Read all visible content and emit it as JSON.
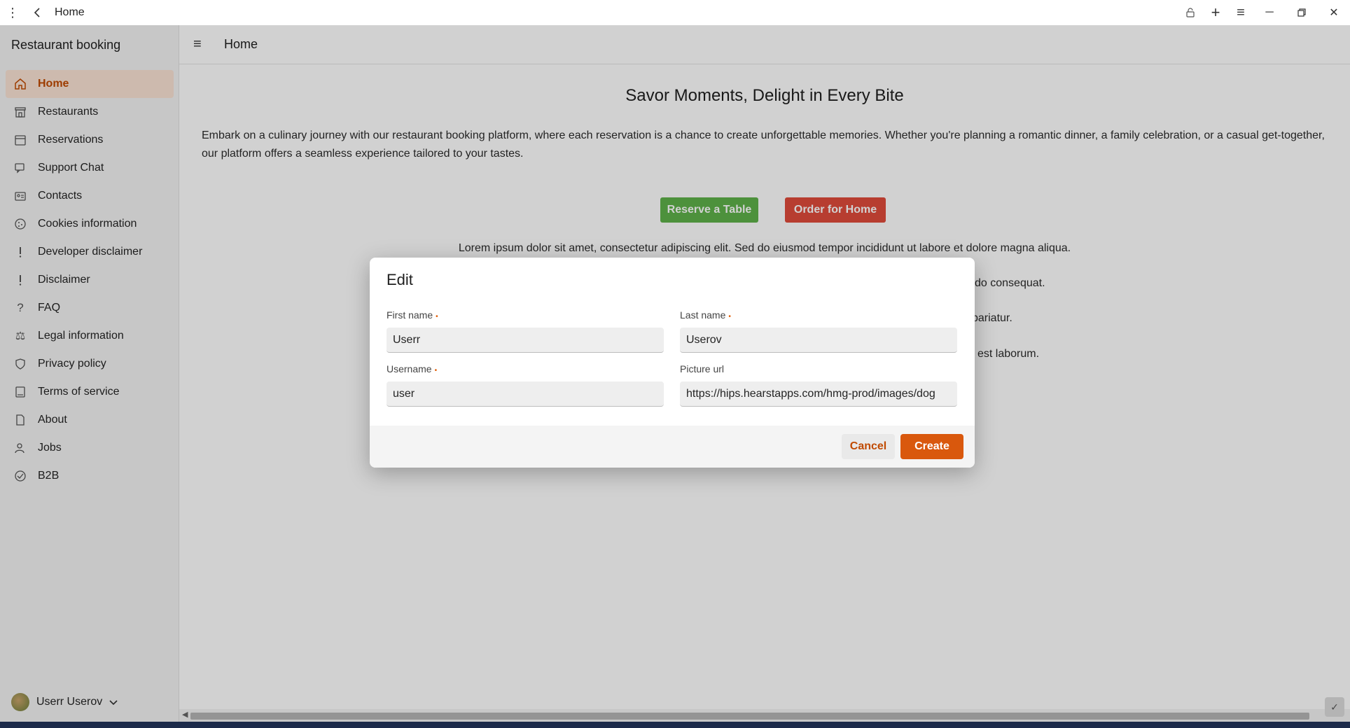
{
  "titlebar": {
    "title": "Home",
    "menu_icon": "more-vertical-icon",
    "back_icon": "back-arrow-icon"
  },
  "app": {
    "name": "Restaurant booking",
    "header_title": "Home"
  },
  "sidebar": {
    "items": [
      {
        "label": "Home",
        "icon": "home-icon",
        "active": true
      },
      {
        "label": "Restaurants",
        "icon": "restaurant-icon"
      },
      {
        "label": "Reservations",
        "icon": "calendar-icon"
      },
      {
        "label": "Support Chat",
        "icon": "chat-icon"
      },
      {
        "label": "Contacts",
        "icon": "contact-card-icon"
      },
      {
        "label": "Cookies information",
        "icon": "cookie-icon"
      },
      {
        "label": "Developer disclaimer",
        "icon": "exclamation-icon"
      },
      {
        "label": "Disclaimer",
        "icon": "exclamation-icon"
      },
      {
        "label": "FAQ",
        "icon": "question-icon"
      },
      {
        "label": "Legal information",
        "icon": "scales-icon"
      },
      {
        "label": "Privacy policy",
        "icon": "shield-icon"
      },
      {
        "label": "Terms of service",
        "icon": "document-icon"
      },
      {
        "label": "About",
        "icon": "page-icon"
      },
      {
        "label": "Jobs",
        "icon": "person-icon"
      },
      {
        "label": "B2B",
        "icon": "handshake-icon"
      }
    ],
    "user_name": "Userr Userov"
  },
  "main": {
    "title": "Savor Moments, Delight in Every Bite",
    "intro": "Embark on a culinary journey with our restaurant booking platform, where each reservation is a chance to create unforgettable memories. Whether you're planning a romantic dinner, a family celebration, or a casual get-together, our platform offers a seamless experience tailored to your tastes.",
    "reserve_label": "Reserve a Table",
    "order_label": "Order for Home",
    "lorem1": "Lorem ipsum dolor sit amet, consectetur adipiscing elit. Sed do eiusmod tempor incididunt ut labore et dolore magna aliqua.",
    "lorem2_tail": "do consequat.",
    "lorem3_tail": "pariatur.",
    "lorem4_tail": "l est laborum."
  },
  "dialog": {
    "title": "Edit",
    "first_name_label": "First name",
    "first_name_value": "Userr",
    "last_name_label": "Last name",
    "last_name_value": "Userov",
    "username_label": "Username",
    "username_value": "user",
    "picture_url_label": "Picture url",
    "picture_url_value": "https://hips.hearstapps.com/hmg-prod/images/dog",
    "required_mark": "•",
    "cancel_label": "Cancel",
    "create_label": "Create"
  },
  "colors": {
    "accent": "#d9580d",
    "active_nav_bg": "#fbe3d5",
    "reserve_button": "#5fb14a",
    "order_button": "#e04b3b"
  }
}
